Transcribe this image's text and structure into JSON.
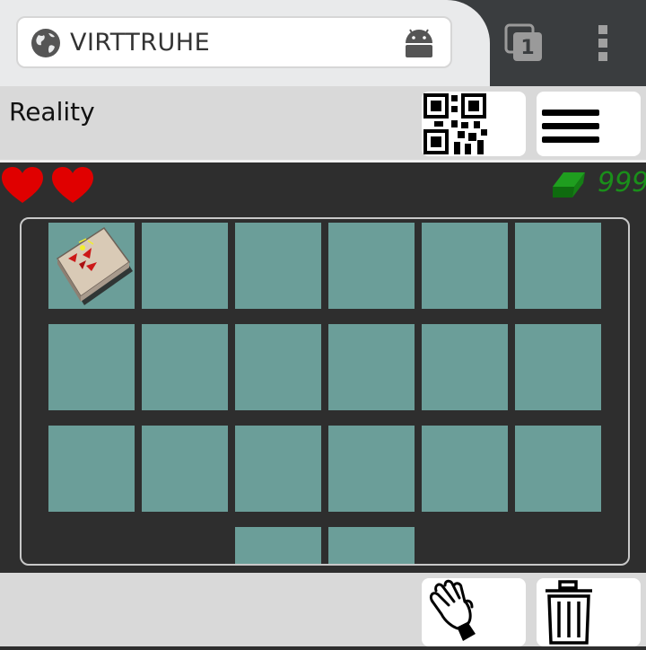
{
  "browser": {
    "url_text": "VIRTTRUHE",
    "tab_count": "1"
  },
  "app": {
    "title": "Reality"
  },
  "status": {
    "hearts": 2,
    "gem_count": "999",
    "gem_color": "#1a8f1a"
  },
  "inventory": {
    "slot_color": "#6b9e99",
    "slots": [
      {
        "item": "chest-map"
      },
      {
        "item": null
      },
      {
        "item": null
      },
      {
        "item": null
      },
      {
        "item": null
      },
      {
        "item": null
      },
      {
        "item": null
      },
      {
        "item": null
      },
      {
        "item": null
      },
      {
        "item": null
      },
      {
        "item": null
      },
      {
        "item": null
      },
      {
        "item": null
      },
      {
        "item": null
      },
      {
        "item": null
      },
      {
        "item": null
      },
      {
        "item": null
      },
      {
        "item": null
      },
      {
        "item": null
      },
      {
        "item": null
      }
    ]
  },
  "icons": {
    "globe": "globe-icon",
    "android": "android-icon",
    "tabs": "tabs-icon",
    "overflow": "overflow-menu-icon",
    "qr": "qr-code-icon",
    "hamburger": "hamburger-menu-icon",
    "heart": "heart-icon",
    "gem": "gem-icon",
    "grab": "hand-icon",
    "trash": "trash-icon"
  }
}
